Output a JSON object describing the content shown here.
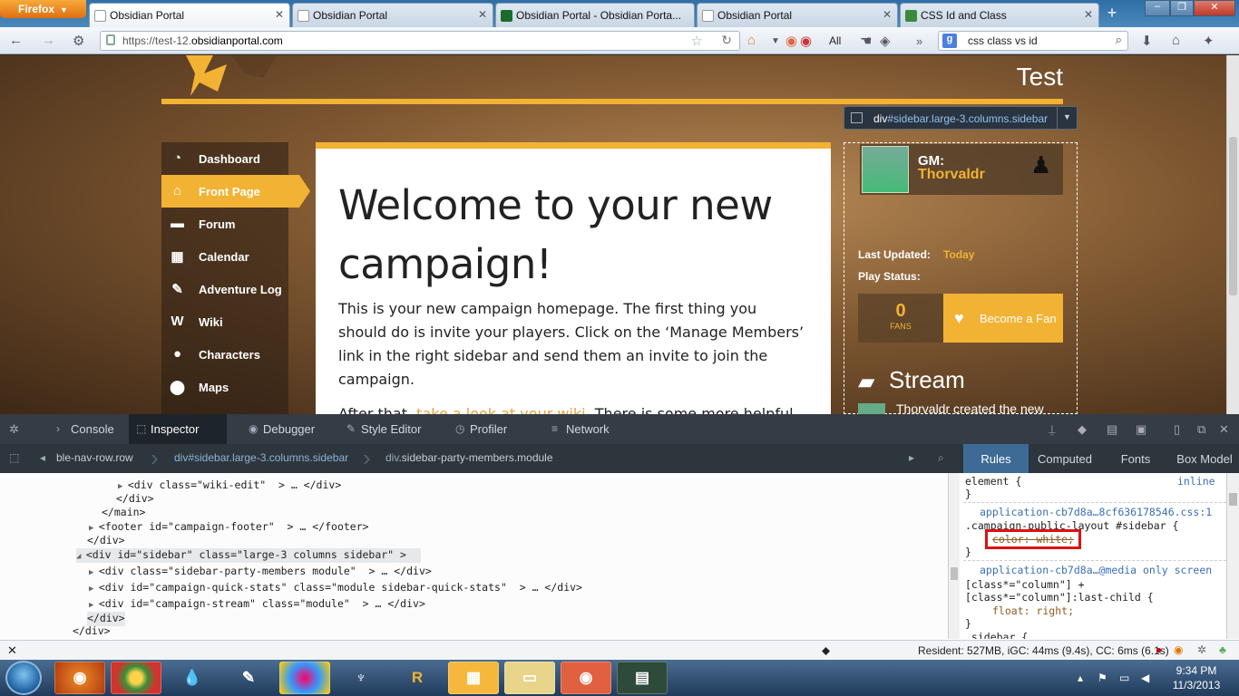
{
  "browser": {
    "menu_label": "Firefox",
    "tabs": [
      {
        "title": "Obsidian Portal",
        "active": true
      },
      {
        "title": "Obsidian Portal",
        "active": false
      },
      {
        "title": "Obsidian Portal - Obsidian Porta...",
        "active": false
      },
      {
        "title": "Obsidian Portal",
        "active": false
      },
      {
        "title": "CSS Id and Class",
        "active": false
      }
    ],
    "url_prefix": "https://test-12.",
    "url_host": "obsidianportal.com",
    "bookmarks_label": "All",
    "search_query": "css class vs id"
  },
  "site": {
    "title": "Test",
    "nav": [
      {
        "label": "Dashboard",
        "icon": "dashboard-icon",
        "glyph": "◔"
      },
      {
        "label": "Front Page",
        "icon": "home-icon",
        "glyph": "⌂"
      },
      {
        "label": "Forum",
        "icon": "chat-icon",
        "glyph": "▬"
      },
      {
        "label": "Calendar",
        "icon": "calendar-icon",
        "glyph": "▦"
      },
      {
        "label": "Adventure Log",
        "icon": "log-icon",
        "glyph": "✎"
      },
      {
        "label": "Wiki",
        "icon": "wiki-icon",
        "glyph": "W"
      },
      {
        "label": "Characters",
        "icon": "characters-icon",
        "glyph": "●"
      },
      {
        "label": "Maps",
        "icon": "map-pin-icon",
        "glyph": "⬤"
      }
    ],
    "active_nav": "Front Page",
    "heading": "Welcome to your new campaign!",
    "intro": "This is your new campaign homepage. The first thing you should do is invite your players. Click on the ‘Manage Members’ link in the right sidebar and send them an invite to join the campaign.",
    "after_prefix": "After that, ",
    "after_link": "take a look at your wiki",
    "after_suffix": ". There is some more helpful info there.",
    "sidebar": {
      "gm_label": "GM:",
      "gm_name": "Thorvaldr",
      "last_updated_label": "Last Updated:",
      "last_updated_value": "Today",
      "play_status_label": "Play Status:",
      "fans_count": "0",
      "fans_label": "FANS",
      "become_fan": "Become a Fan",
      "stream_title": "Stream",
      "stream_item": "Thorvaldr created the new"
    },
    "inspector_tooltip_tag": "div",
    "inspector_tooltip_selector": "#sidebar.large-3.columns.sidebar"
  },
  "devtools": {
    "tabs": [
      "Console",
      "Inspector",
      "Debugger",
      "Style Editor",
      "Profiler",
      "Network"
    ],
    "active_tab": "Inspector",
    "breadcrumbs": [
      {
        "tag": "",
        "cls": "ble-nav-row.row"
      },
      {
        "tag": "div",
        "cls": "#sidebar.large-3.columns.sidebar"
      },
      {
        "tag": "div",
        "cls": ".sidebar-party-members.module"
      }
    ],
    "side_tabs": [
      "Rules",
      "Computed",
      "Fonts",
      "Box Model"
    ],
    "active_side_tab": "Rules",
    "markup": [
      {
        "indent": "        ",
        "twisty": "",
        "html": "<div class=\"wiki-edit\"  > … </div>"
      },
      {
        "indent": "        ",
        "twisty": "",
        "html": "</div>"
      },
      {
        "indent": "      ",
        "twisty": "",
        "html": "</main>"
      },
      {
        "indent": "    ",
        "twisty": "",
        "html": "<footer id=\"campaign-footer\"  > … </footer>"
      },
      {
        "indent": "  ",
        "twisty": "",
        "html": "</div>"
      },
      {
        "indent": "",
        "twisty": "",
        "html": "<div id=\"sidebar\" class=\"large-3 columns sidebar\" >"
      },
      {
        "indent": "  ",
        "twisty": "",
        "html": "<div class=\"sidebar-party-members module\"  > … </div>"
      },
      {
        "indent": "  ",
        "twisty": "",
        "html": "<div id=\"campaign-quick-stats\" class=\"module sidebar-quick-stats\"  > … </div>"
      },
      {
        "indent": "  ",
        "twisty": "",
        "html": "<div id=\"campaign-stream\" class=\"module\"  > … </div>"
      },
      {
        "indent": "",
        "twisty": "",
        "html": "</div>"
      },
      {
        "indent": "",
        "twisty": "",
        "html": "</div>"
      }
    ],
    "rules": {
      "element_rule": "element {",
      "element_source": "inline",
      "close": "}",
      "source1": "application-cb7d8a…8cf636178546.css:1",
      "selector1": ".campaign-public-layout #sidebar {",
      "prop1": "color: white;",
      "source2": "application-cb7d8a…@media only screen",
      "selector2a": "[class*=\"column\"] +",
      "selector2b": "[class*=\"column\"]:last-child {",
      "prop2": "float: right;",
      "selector3": ".sidebar {"
    },
    "status_text": "Resident: 527MB, iGC: 44ms (9.4s), CC: 6ms (6.1s)"
  },
  "taskbar": {
    "time": "9:34 PM",
    "date": "11/3/2013"
  },
  "colors": {
    "accent": "#f2b233",
    "highlight_box": "#e01010"
  }
}
